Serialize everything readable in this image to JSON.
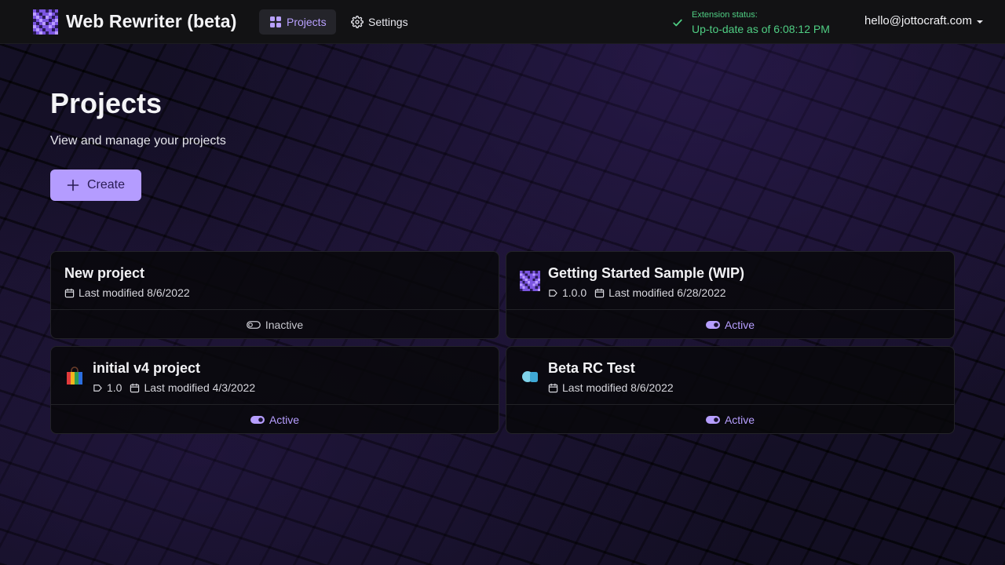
{
  "app": {
    "title": "Web Rewriter (beta)",
    "accent_color": "#b49cff"
  },
  "nav": {
    "tabs": [
      {
        "label": "Projects",
        "icon": "grid-icon",
        "active": true
      },
      {
        "label": "Settings",
        "icon": "gear-icon",
        "active": false
      }
    ]
  },
  "extension_status": {
    "label": "Extension status:",
    "value": "Up-to-date as of 6:08:12 PM",
    "color": "#4fce83"
  },
  "user": {
    "email": "hello@jottocraft.com"
  },
  "page": {
    "title": "Projects",
    "subtitle": "View and manage your projects",
    "create_label": "Create"
  },
  "projects": [
    {
      "name": "New project",
      "version": "",
      "modified": "Last modified 8/6/2022",
      "status": "Inactive",
      "icon": ""
    },
    {
      "name": "Getting Started Sample (WIP)",
      "version": "1.0.0",
      "modified": "Last modified 6/28/2022",
      "status": "Active",
      "icon": "pixel-logo-icon"
    },
    {
      "name": "initial v4 project",
      "version": "1.0",
      "modified": "Last modified 4/3/2022",
      "status": "Active",
      "icon": "shopping-bag-icon"
    },
    {
      "name": "Beta RC Test",
      "version": "",
      "modified": "Last modified 8/6/2022",
      "status": "Active",
      "icon": "shapes-icon"
    }
  ]
}
